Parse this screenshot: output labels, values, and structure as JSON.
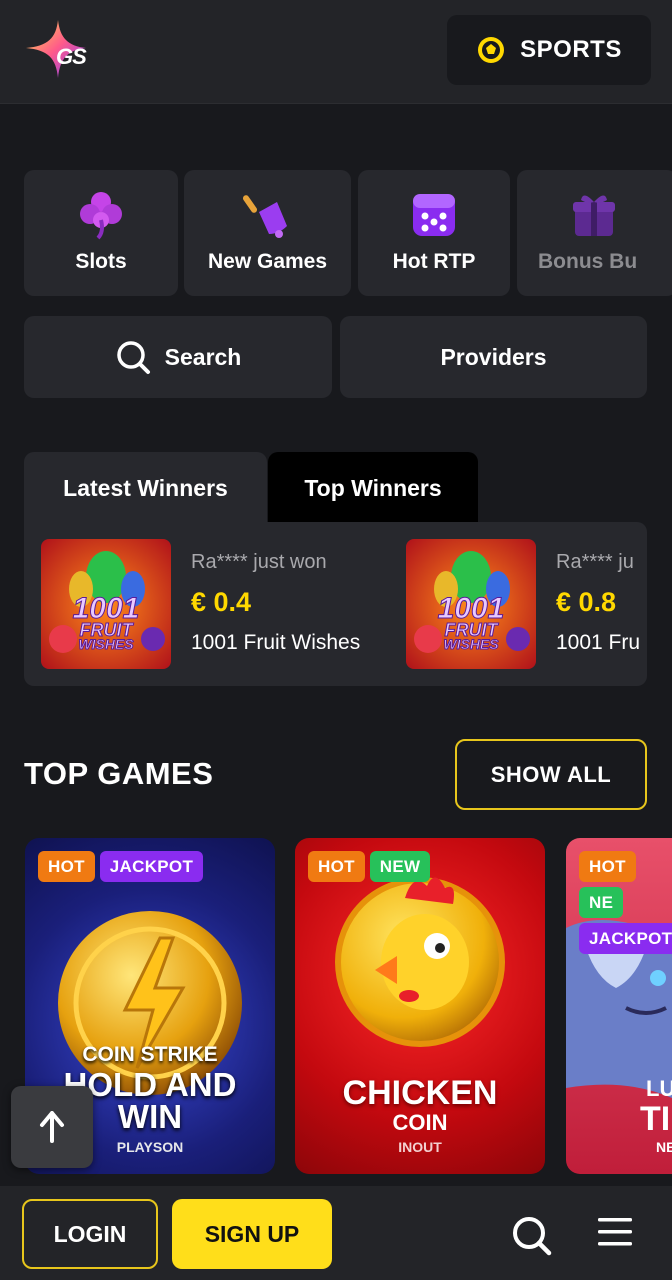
{
  "header": {
    "logo_text": "GS",
    "sports_label": "SPORTS"
  },
  "categories": [
    {
      "label": "Slots",
      "icon": "clover-icon"
    },
    {
      "label": "New Games",
      "icon": "bell-icon"
    },
    {
      "label": "Hot RTP",
      "icon": "dice-icon"
    },
    {
      "label": "Bonus Bu",
      "icon": "gift-icon"
    }
  ],
  "actions": {
    "search_label": "Search",
    "providers_label": "Providers"
  },
  "winners": {
    "tabs": [
      "Latest Winners",
      "Top Winners"
    ],
    "active_tab": "Top Winners",
    "items": [
      {
        "user": "Ra**** just won",
        "amount": "€ 0.4",
        "game": "1001 Fruit Wishes"
      },
      {
        "user": "Ra**** ju",
        "amount": "€ 0.8",
        "game": "1001 Fru"
      }
    ],
    "thumb_text": [
      "1001",
      "FRUIT",
      "WISHES"
    ]
  },
  "top_games": {
    "title": "TOP GAMES",
    "show_all": "SHOW ALL",
    "games": [
      {
        "badges": [
          "HOT",
          "JACKPOT"
        ],
        "title_line1": "COIN STRIKE",
        "title_line2": "HOLD AND",
        "title_line3": "WIN",
        "provider": "PLAYSON"
      },
      {
        "badges": [
          "HOT",
          "NEW"
        ],
        "title_line1": "CHICKEN",
        "title_line2": "COIN",
        "provider": "INOUT"
      },
      {
        "badges": [
          "HOT",
          "NE",
          "JACKPOT"
        ],
        "title_line1": "LU",
        "title_line2": "TI",
        "provider": "NE"
      }
    ]
  },
  "footer": {
    "login_label": "LOGIN",
    "signup_label": "SIGN UP"
  },
  "colors": {
    "accent_yellow": "#ffde1a",
    "amount_yellow": "#ffd800",
    "background": "#18191d",
    "card": "#27282d"
  }
}
